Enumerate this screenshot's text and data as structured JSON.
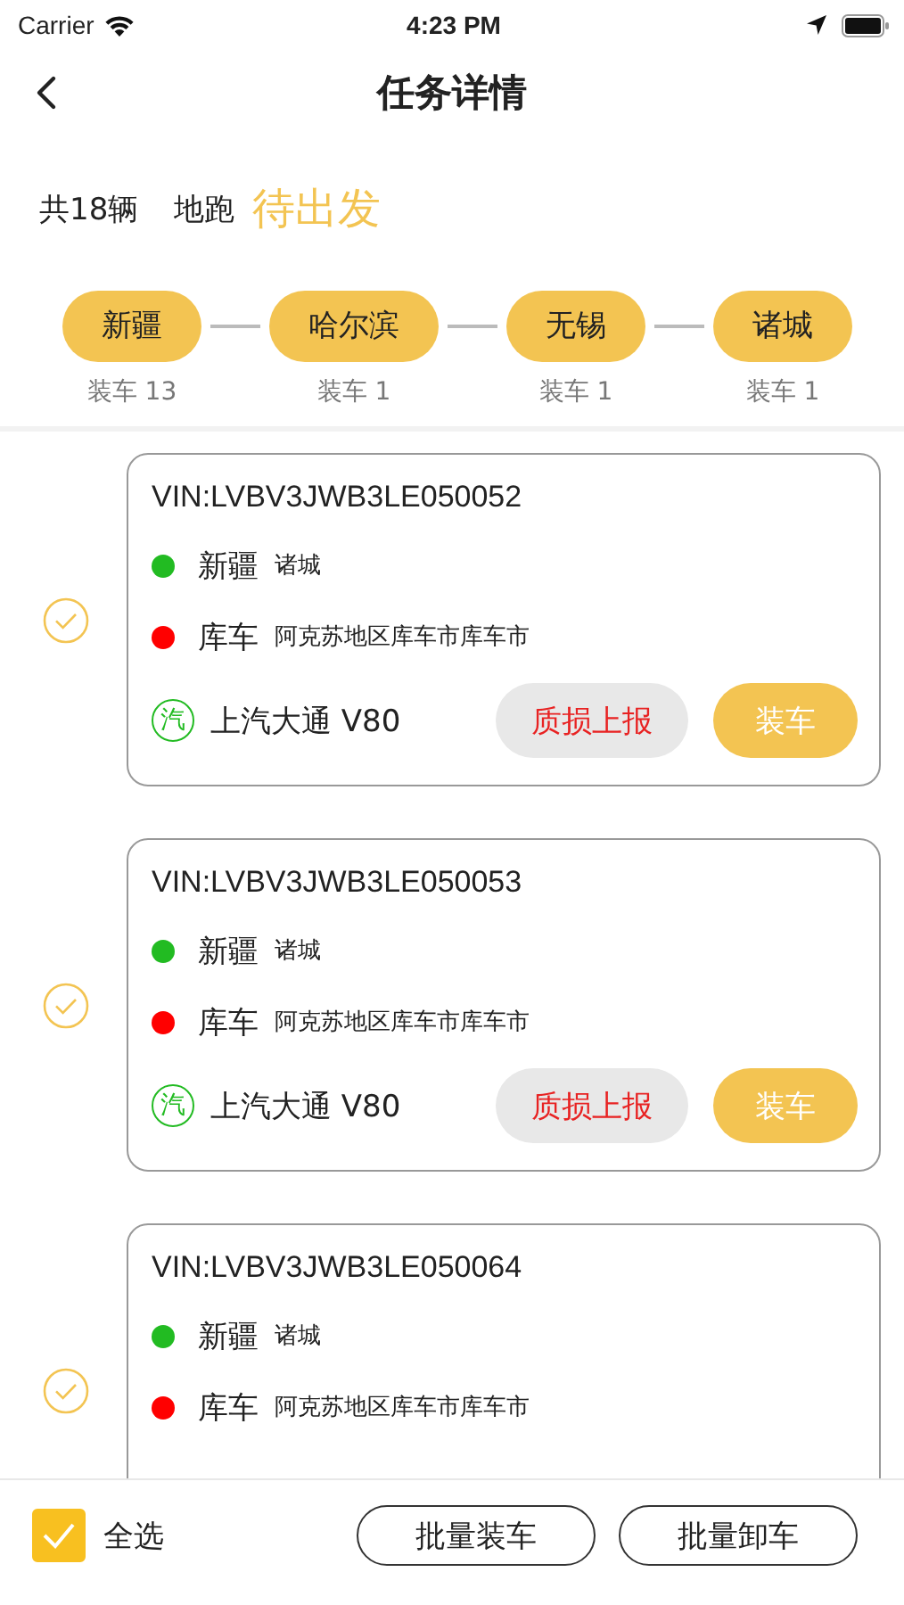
{
  "status_bar": {
    "carrier": "Carrier",
    "time": "4:23 PM"
  },
  "nav": {
    "title": "任务详情"
  },
  "summary": {
    "count": "共18辆",
    "mode": "地跑",
    "status": "待出发"
  },
  "stops": [
    {
      "name": "新疆",
      "note": "装车 13"
    },
    {
      "name": "哈尔滨",
      "note": "装车 1"
    },
    {
      "name": "无锡",
      "note": "装车 1"
    },
    {
      "name": "诸城",
      "note": "装车 1"
    }
  ],
  "vehicles": [
    {
      "checked": false,
      "vin": "VIN:LVBV3JWB3LE050052",
      "origin": {
        "city": "新疆",
        "detail": "诸城",
        "color": "#22bb22"
      },
      "destination": {
        "city": "库车",
        "detail": "阿克苏地区库车市库车市",
        "color": "#ff0000"
      },
      "brand_mark": "汽",
      "model": "上汽大通 V80",
      "actions": [
        "质损上报",
        "装车"
      ]
    },
    {
      "checked": false,
      "vin": "VIN:LVBV3JWB3LE050053",
      "origin": {
        "city": "新疆",
        "detail": "诸城",
        "color": "#22bb22"
      },
      "destination": {
        "city": "库车",
        "detail": "阿克苏地区库车市库车市",
        "color": "#ff0000"
      },
      "brand_mark": "汽",
      "model": "上汽大通 V80",
      "actions": [
        "质损上报",
        "装车"
      ]
    },
    {
      "checked": false,
      "vin": "VIN:LVBV3JWB3LE050064",
      "origin": {
        "city": "新疆",
        "detail": "诸城",
        "color": "#22bb22"
      },
      "destination": {
        "city": "库车",
        "detail": "阿克苏地区库车市库车市",
        "color": "#ff0000"
      }
    }
  ],
  "footer": {
    "select_all": {
      "label": "全选",
      "checked": true
    },
    "buttons": [
      "批量装车",
      "批量卸车"
    ]
  }
}
